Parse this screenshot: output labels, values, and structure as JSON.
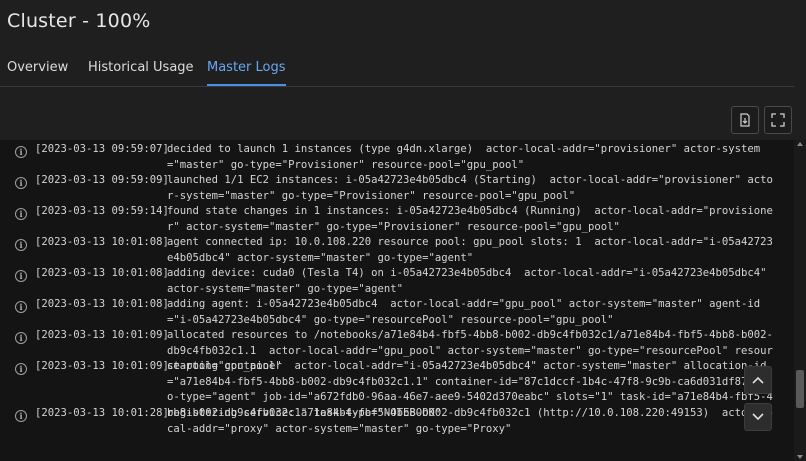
{
  "page": {
    "title": "Cluster - 100%"
  },
  "tabs": [
    {
      "label": "Overview"
    },
    {
      "label": "Historical Usage"
    },
    {
      "label": "Master Logs"
    }
  ],
  "active_tab": "Master Logs",
  "colors": {
    "accent": "#4b8fe6",
    "background": "#1f1f1f",
    "log_background": "#141414"
  },
  "toolbar": {
    "download_icon": "download-file-icon",
    "fullscreen_icon": "fullscreen-icon"
  },
  "logs": [
    {
      "timestamp": "[2023-03-13 09:59:07]",
      "message": "decided to launch 1 instances (type g4dn.xlarge)  actor-local-addr=\"provisioner\" actor-system=\"master\" go-type=\"Provisioner\" resource-pool=\"gpu_pool\""
    },
    {
      "timestamp": "[2023-03-13 09:59:09]",
      "message": "launched 1/1 EC2 instances: i-05a42723e4b05dbc4 (Starting)  actor-local-addr=\"provisioner\" actor-system=\"master\" go-type=\"Provisioner\" resource-pool=\"gpu_pool\""
    },
    {
      "timestamp": "[2023-03-13 09:59:14]",
      "message": "found state changes in 1 instances: i-05a42723e4b05dbc4 (Running)  actor-local-addr=\"provisioner\" actor-system=\"master\" go-type=\"Provisioner\" resource-pool=\"gpu_pool\""
    },
    {
      "timestamp": "[2023-03-13 10:01:08]",
      "message": "agent connected ip: 10.0.108.220 resource pool: gpu_pool slots: 1  actor-local-addr=\"i-05a42723e4b05dbc4\" actor-system=\"master\" go-type=\"agent\""
    },
    {
      "timestamp": "[2023-03-13 10:01:08]",
      "message": "adding device: cuda0 (Tesla T4) on i-05a42723e4b05dbc4  actor-local-addr=\"i-05a42723e4b05dbc4\" actor-system=\"master\" go-type=\"agent\""
    },
    {
      "timestamp": "[2023-03-13 10:01:08]",
      "message": "adding agent: i-05a42723e4b05dbc4  actor-local-addr=\"gpu_pool\" actor-system=\"master\" agent-id=\"i-05a42723e4b05dbc4\" go-type=\"resourcePool\" resource-pool=\"gpu_pool\""
    },
    {
      "timestamp": "[2023-03-13 10:01:09]",
      "message": "allocated resources to /notebooks/a71e84b4-fbf5-4bb8-b002-db9c4fb032c1/a71e84b4-fbf5-4bb8-b002-db9c4fb032c1.1  actor-local-addr=\"gpu_pool\" actor-system=\"master\" go-type=\"resourcePool\" resource-pool=\"gpu_pool\""
    },
    {
      "timestamp": "[2023-03-13 10:01:09]",
      "message": "starting container  actor-local-addr=\"i-05a42723e4b05dbc4\" actor-system=\"master\" allocation-id=\"a71e84b4-fbf5-4bb8-b002-db9c4fb032c1.1\" container-id=\"87c1dccf-1b4c-47f8-9c9b-ca6d031df872\" go-type=\"agent\" job-id=\"a672fdb0-96aa-46e7-aee9-5402d370eabc\" slots=\"1\" task-id=\"a71e84b4-fbf5-4bb8-b002-db9c4fb032c1\" task-type=\"NOTEBOOK\""
    },
    {
      "timestamp": "[2023-03-13 10:01:28]",
      "message": "registering service: a71e84b4-fbf5-4bb8-b002-db9c4fb032c1 (http://10.0.108.220:49153)  actor-local-addr=\"proxy\" actor-system=\"master\" go-type=\"Proxy\""
    }
  ],
  "floating": {
    "scroll_top_icon": "chevron-up-icon",
    "scroll_bottom_icon": "chevron-down-icon"
  }
}
